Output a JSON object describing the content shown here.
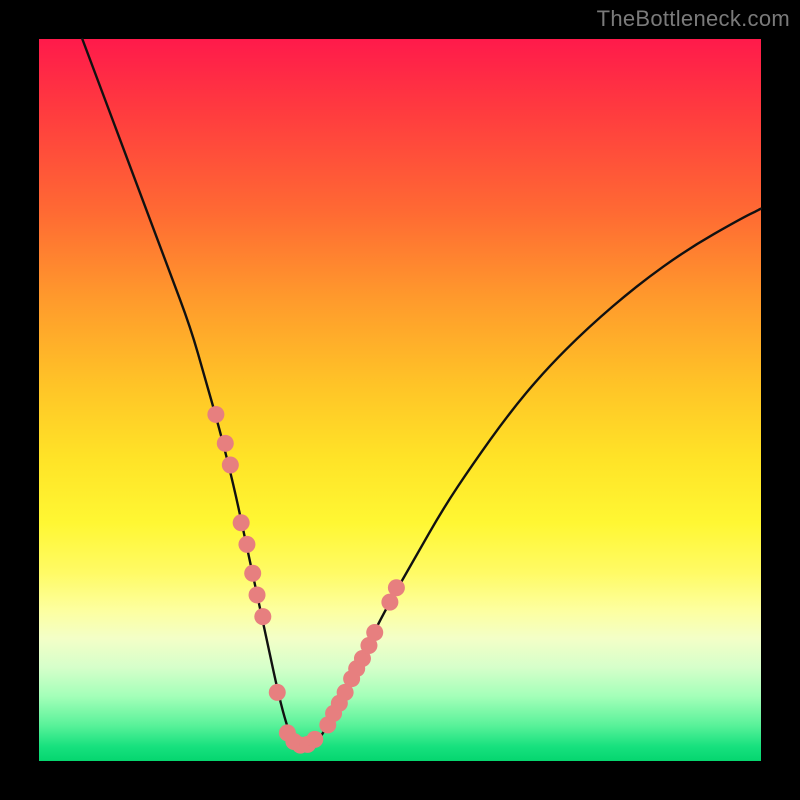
{
  "watermark": "TheBottleneck.com",
  "colors": {
    "page_bg": "#000000",
    "grad_top": "#ff1a4b",
    "grad_bottom": "#05d66f",
    "curve": "#111111",
    "marker": "#e77f7f"
  },
  "chart_data": {
    "type": "line",
    "title": "",
    "xlabel": "",
    "ylabel": "",
    "xlim": [
      0,
      100
    ],
    "ylim": [
      0,
      100
    ],
    "grid": false,
    "legend": false,
    "series": [
      {
        "name": "curve",
        "x": [
          6,
          9,
          12,
          15,
          18,
          21,
          23,
          25,
          27,
          28.5,
          30,
          31.5,
          33,
          34,
          35,
          36,
          37,
          38.5,
          40,
          42,
          45,
          48,
          52,
          56,
          60,
          65,
          70,
          76,
          83,
          90,
          97,
          100
        ],
        "y": [
          100,
          92,
          84,
          76,
          68,
          60,
          53,
          46,
          38,
          31,
          24,
          17,
          10,
          6,
          3,
          1.5,
          1.5,
          2.5,
          5,
          9,
          15,
          21,
          28,
          35,
          41,
          48,
          54,
          60,
          66,
          71,
          75,
          76.5
        ]
      },
      {
        "name": "markers_left",
        "x": [
          24.5,
          25.8,
          26.5,
          28.0,
          28.8,
          29.6,
          30.2,
          31.0,
          33.0
        ],
        "y": [
          48,
          44,
          41,
          33,
          30,
          26,
          23,
          20,
          9.5
        ]
      },
      {
        "name": "markers_bottom",
        "x": [
          34.4,
          35.3,
          36.2,
          37.2,
          38.2
        ],
        "y": [
          3.9,
          2.7,
          2.2,
          2.3,
          3.0
        ]
      },
      {
        "name": "markers_right",
        "x": [
          40.0,
          40.8,
          41.6,
          42.4,
          43.3,
          44.0,
          44.8,
          45.7,
          46.5,
          48.6,
          49.5
        ],
        "y": [
          5.0,
          6.6,
          8.0,
          9.5,
          11.4,
          12.8,
          14.2,
          16.0,
          17.8,
          22.0,
          24.0
        ]
      }
    ]
  }
}
